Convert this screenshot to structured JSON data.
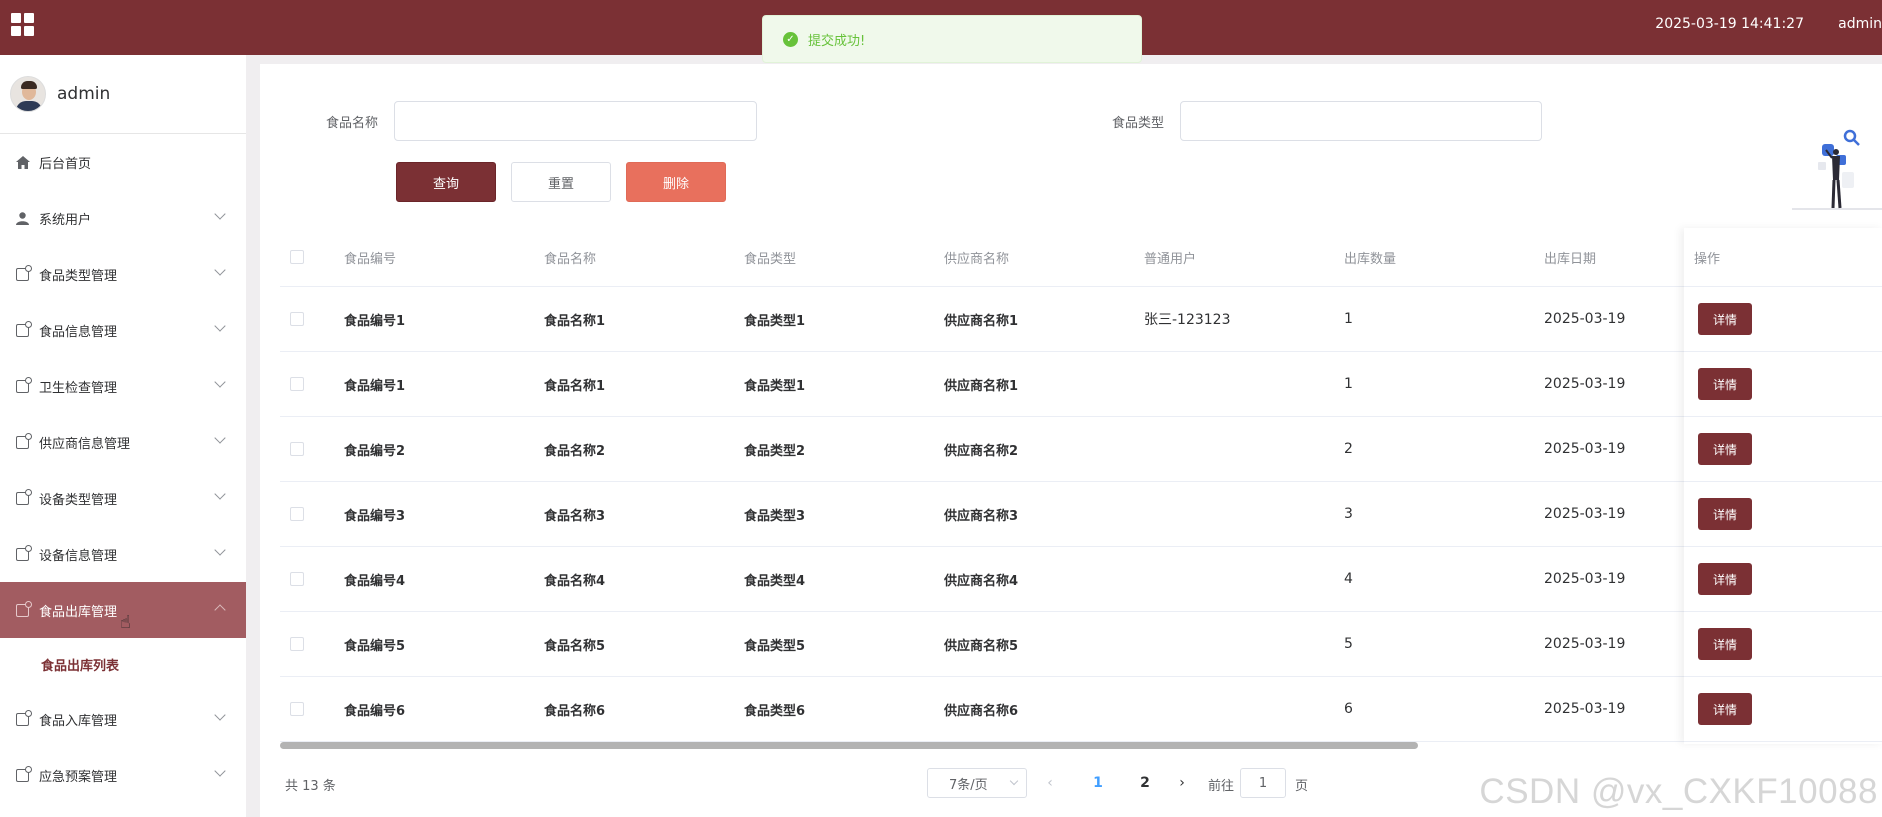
{
  "topbar": {
    "datetime": "2025-03-19 14:41:27",
    "user": "admin",
    "menu_icon": "grid-icon"
  },
  "toast": {
    "message": "提交成功!",
    "icon": "check-circle-icon",
    "color": "#67c23a"
  },
  "sidebar": {
    "username": "admin",
    "items": [
      {
        "label": "后台首页",
        "icon": "home-icon"
      },
      {
        "label": "系统用户",
        "icon": "user-icon"
      },
      {
        "label": "食品类型管理",
        "icon": "doc-icon"
      },
      {
        "label": "食品信息管理",
        "icon": "doc-icon"
      },
      {
        "label": "卫生检查管理",
        "icon": "doc-icon"
      },
      {
        "label": "供应商信息管理",
        "icon": "doc-icon"
      },
      {
        "label": "设备类型管理",
        "icon": "doc-icon"
      },
      {
        "label": "设备信息管理",
        "icon": "doc-icon"
      },
      {
        "label": "食品出库管理",
        "icon": "doc-icon",
        "active": true
      },
      {
        "label": "食品入库管理",
        "icon": "doc-icon"
      },
      {
        "label": "应急预案管理",
        "icon": "doc-icon"
      }
    ],
    "submenu": {
      "label": "食品出库列表"
    }
  },
  "search": {
    "food_name_label": "食品名称",
    "food_name_value": "",
    "food_type_label": "食品类型",
    "food_type_value": ""
  },
  "buttons": {
    "query": "查询",
    "reset": "重置",
    "delete": "删除"
  },
  "table": {
    "headers": [
      "食品编号",
      "食品名称",
      "食品类型",
      "供应商名称",
      "普通用户",
      "出库数量",
      "出库日期",
      "操作"
    ],
    "detail_label": "详情",
    "rows": [
      [
        "食品编号1",
        "食品名称1",
        "食品类型1",
        "供应商名称1",
        "张三-123123",
        "1",
        "2025-03-19"
      ],
      [
        "食品编号1",
        "食品名称1",
        "食品类型1",
        "供应商名称1",
        "",
        "1",
        "2025-03-19"
      ],
      [
        "食品编号2",
        "食品名称2",
        "食品类型2",
        "供应商名称2",
        "",
        "2",
        "2025-03-19"
      ],
      [
        "食品编号3",
        "食品名称3",
        "食品类型3",
        "供应商名称3",
        "",
        "3",
        "2025-03-19"
      ],
      [
        "食品编号4",
        "食品名称4",
        "食品类型4",
        "供应商名称4",
        "",
        "4",
        "2025-03-19"
      ],
      [
        "食品编号5",
        "食品名称5",
        "食品类型5",
        "供应商名称5",
        "",
        "5",
        "2025-03-19"
      ],
      [
        "食品编号6",
        "食品名称6",
        "食品类型6",
        "供应商名称6",
        "",
        "6",
        "2025-03-19"
      ]
    ]
  },
  "pagination": {
    "total": "共 13 条",
    "page_size": "7条/页",
    "pages": [
      "1",
      "2"
    ],
    "current": "1",
    "goto_label": "前往",
    "goto_value": "1",
    "goto_suffix": "页"
  },
  "watermark": "CSDN @vx_CXKF10088",
  "colors": {
    "brand": "#7b3034",
    "active_menu": "#a25c61",
    "delete": "#e8705d",
    "success": "#67c23a"
  }
}
